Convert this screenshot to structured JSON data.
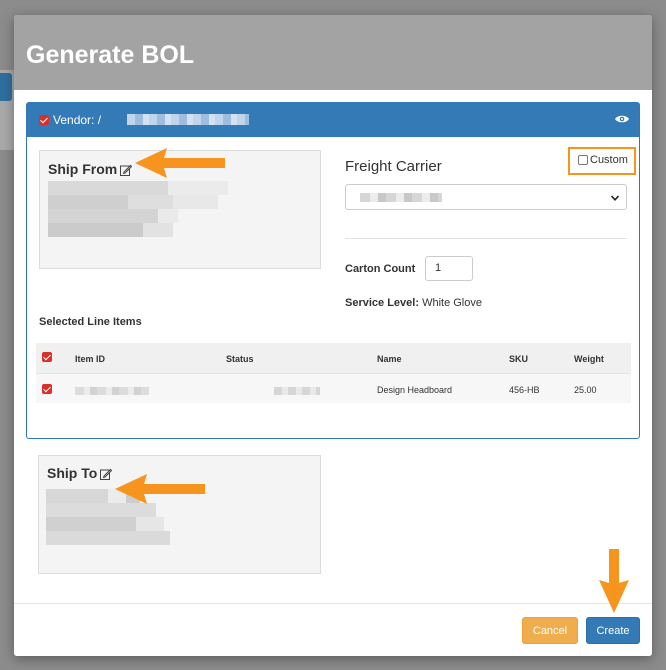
{
  "modal": {
    "title": "Generate BOL"
  },
  "vendor_panel": {
    "vendor_label": "Vendor: /",
    "ship_from_title": "Ship From",
    "freight_carrier_label": "Freight Carrier",
    "custom_label": "Custom",
    "carton_count_label": "Carton Count",
    "carton_count_value": "1",
    "service_level_label": "Service Level:",
    "service_level_value": "White Glove",
    "selected_line_items_label": "Selected Line Items"
  },
  "line_items_table": {
    "columns": [
      "Item ID",
      "Status",
      "Name",
      "SKU",
      "Weight"
    ],
    "rows": [
      {
        "item_id": "",
        "status": "",
        "name": "Design Headboard",
        "sku": "456-HB",
        "weight": "25.00"
      }
    ]
  },
  "ship_to": {
    "title": "Ship To"
  },
  "footer": {
    "cancel_label": "Cancel",
    "create_label": "Create"
  },
  "colors": {
    "primary": "#337ab7",
    "warning": "#f0ad4e",
    "annotation_orange": "#f7941d",
    "checkbox_red": "#d9302c"
  },
  "icons": [
    "eye-icon",
    "edit-icon",
    "chevron-down-icon",
    "checkbox-icon",
    "arrow-annotation"
  ]
}
